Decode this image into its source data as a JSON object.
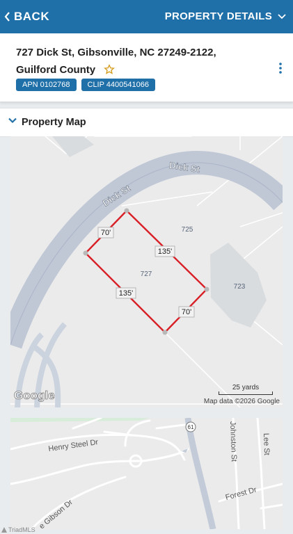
{
  "topbar": {
    "back_label": "BACK",
    "details_label": "PROPERTY DETAILS",
    "color": "#1f6fa8"
  },
  "header": {
    "address": "727 Dick St, Gibsonville, NC 27249-2122, Guilford County",
    "apn": "APN 0102768",
    "clip": "CLIP 4400541066"
  },
  "section": {
    "title": "Property Map"
  },
  "map1": {
    "street_upper": "Dick St",
    "street_lower": "Dick St",
    "parcels": {
      "lot_main": "727",
      "lot_north": "725",
      "lot_east": "723"
    },
    "dimensions": {
      "nw": "70'",
      "ne": "135'",
      "sw": "135'",
      "se": "70'"
    },
    "scale_label": "25 yards",
    "attribution": "Map data ©2026 Google",
    "logo": "Google"
  },
  "map2": {
    "route_number": "61",
    "streets": {
      "henry_steel": "Henry Steel Dr",
      "johnston": "Johnston St",
      "lee": "Lee St",
      "forest": "Forest Dr",
      "gibson": "e Gibson Dr"
    }
  },
  "footer": {
    "brand": "TriadMLS"
  },
  "icons": {
    "back": "chevron-left-icon",
    "details": "chevron-down-icon",
    "favorite": "star-outline-icon",
    "menu": "kebab-menu-icon",
    "section": "chevron-down-icon"
  }
}
